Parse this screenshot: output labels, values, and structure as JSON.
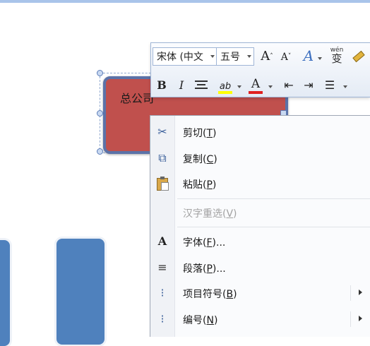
{
  "canvas": {
    "org_box_text": "总公司"
  },
  "mini_toolbar": {
    "font_name": "宋体 (中文",
    "font_size": "五号",
    "grow_font_glyph": "A",
    "shrink_font_glyph": "A",
    "styles_glyph": "A",
    "pinyin_glyph": "wén",
    "pinyin_char": "变",
    "bold": "B",
    "italic": "I",
    "font_color_glyph": "A",
    "highlight_glyph": "ab",
    "highlight_color": "#ffff00",
    "font_color": "#e02020"
  },
  "context_menu": {
    "items": [
      {
        "label": "剪切(",
        "key": "T",
        "icon": "scissors-icon",
        "glyph": "✂",
        "enabled": true
      },
      {
        "label": "复制(",
        "key": "C",
        "icon": "copy-icon",
        "glyph": "⧉",
        "enabled": true
      },
      {
        "label": "粘贴(",
        "key": "P",
        "icon": "paste-icon",
        "glyph": "📋",
        "enabled": true
      },
      {
        "label": "汉字重选(",
        "key": "V",
        "icon": "",
        "glyph": "",
        "enabled": false
      },
      {
        "label": "字体(",
        "key": "F",
        "suffix": ")...",
        "icon": "font-icon",
        "glyph": "A",
        "enabled": true
      },
      {
        "label": "段落(",
        "key": "P",
        "suffix": ")...",
        "icon": "paragraph-icon",
        "glyph": "≡",
        "enabled": true
      },
      {
        "label": "项目符号(",
        "key": "B",
        "icon": "bullets-icon",
        "glyph": "⁝",
        "enabled": true,
        "submenu": true
      },
      {
        "label": "编号(",
        "key": "N",
        "icon": "numbering-icon",
        "glyph": "⁝",
        "enabled": true,
        "submenu": true
      }
    ]
  }
}
